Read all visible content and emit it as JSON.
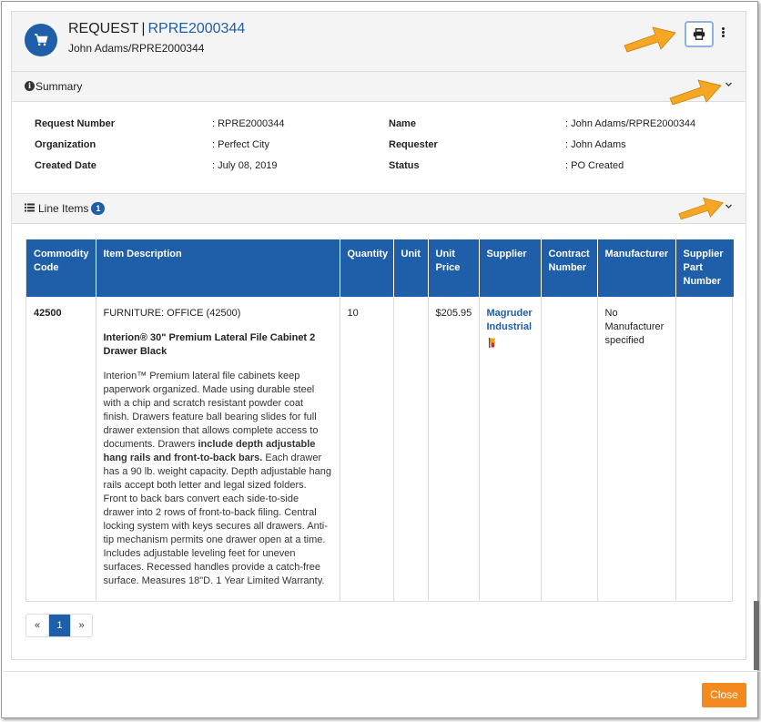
{
  "header": {
    "title_prefix": "REQUEST",
    "separator": "|",
    "request_number": "RPRE2000344",
    "subtitle": "John Adams/RPRE2000344",
    "print_icon": "print-icon",
    "more_icon": "more-vertical-icon"
  },
  "summary": {
    "heading": "Summary",
    "fields": [
      {
        "label": "Request Number",
        "value": ": RPRE2000344"
      },
      {
        "label": "Organization",
        "value": ": Perfect City"
      },
      {
        "label": "Created Date",
        "value": ": July 08, 2019"
      },
      {
        "label": "Name",
        "value": ": John Adams/RPRE2000344"
      },
      {
        "label": "Requester",
        "value": ": John Adams"
      },
      {
        "label": "Status",
        "value": ": PO Created"
      }
    ]
  },
  "line_items": {
    "heading": "Line Items",
    "count": "1",
    "columns": [
      "Commodity Code",
      "Item Description",
      "Quantity",
      "Unit",
      "Unit Price",
      "Supplier",
      "Contract Number",
      "Manufacturer",
      "Supplier Part Number"
    ],
    "rows": [
      {
        "commodity_code": "42500",
        "category": "FURNITURE: OFFICE (42500)",
        "item_name": "Interion® 30\" Premium Lateral File Cabinet 2 Drawer Black",
        "desc_part1": "Interion™ Premium lateral file cabinets keep paperwork organized. Made using durable steel with a chip and scratch resistant powder coat finish. Drawers feature ball bearing slides for full drawer extension that allows complete access to documents. Drawers ",
        "desc_bold": "include depth adjustable hang rails and front-to-back bars.",
        "desc_part2": " Each drawer has a 90 lb. weight capacity. Depth adjustable hang rails accept both letter and legal sized folders. Front to back bars convert each side-to-side drawer into 2 rows of front-to-back filing. Central locking system with keys secures all drawers. Anti-tip mechanism permits one drawer open at a time. Includes adjustable leveling feet for uneven surfaces. Recessed handles provide a catch-free surface. Measures 18\"D. 1 Year Limited Warranty.",
        "quantity": "10",
        "unit": "",
        "unit_price": "$205.95",
        "supplier": "Magruder Industrial",
        "contract_number": "",
        "manufacturer": "No Manufacturer specified",
        "supplier_part_number": ""
      }
    ]
  },
  "pagination": {
    "prev": "«",
    "current": "1",
    "next": "»"
  },
  "footer": {
    "close_label": "Close"
  },
  "colors": {
    "primary": "#1f5ea8",
    "close": "#f28a1f",
    "arrow": "#f5a623"
  }
}
